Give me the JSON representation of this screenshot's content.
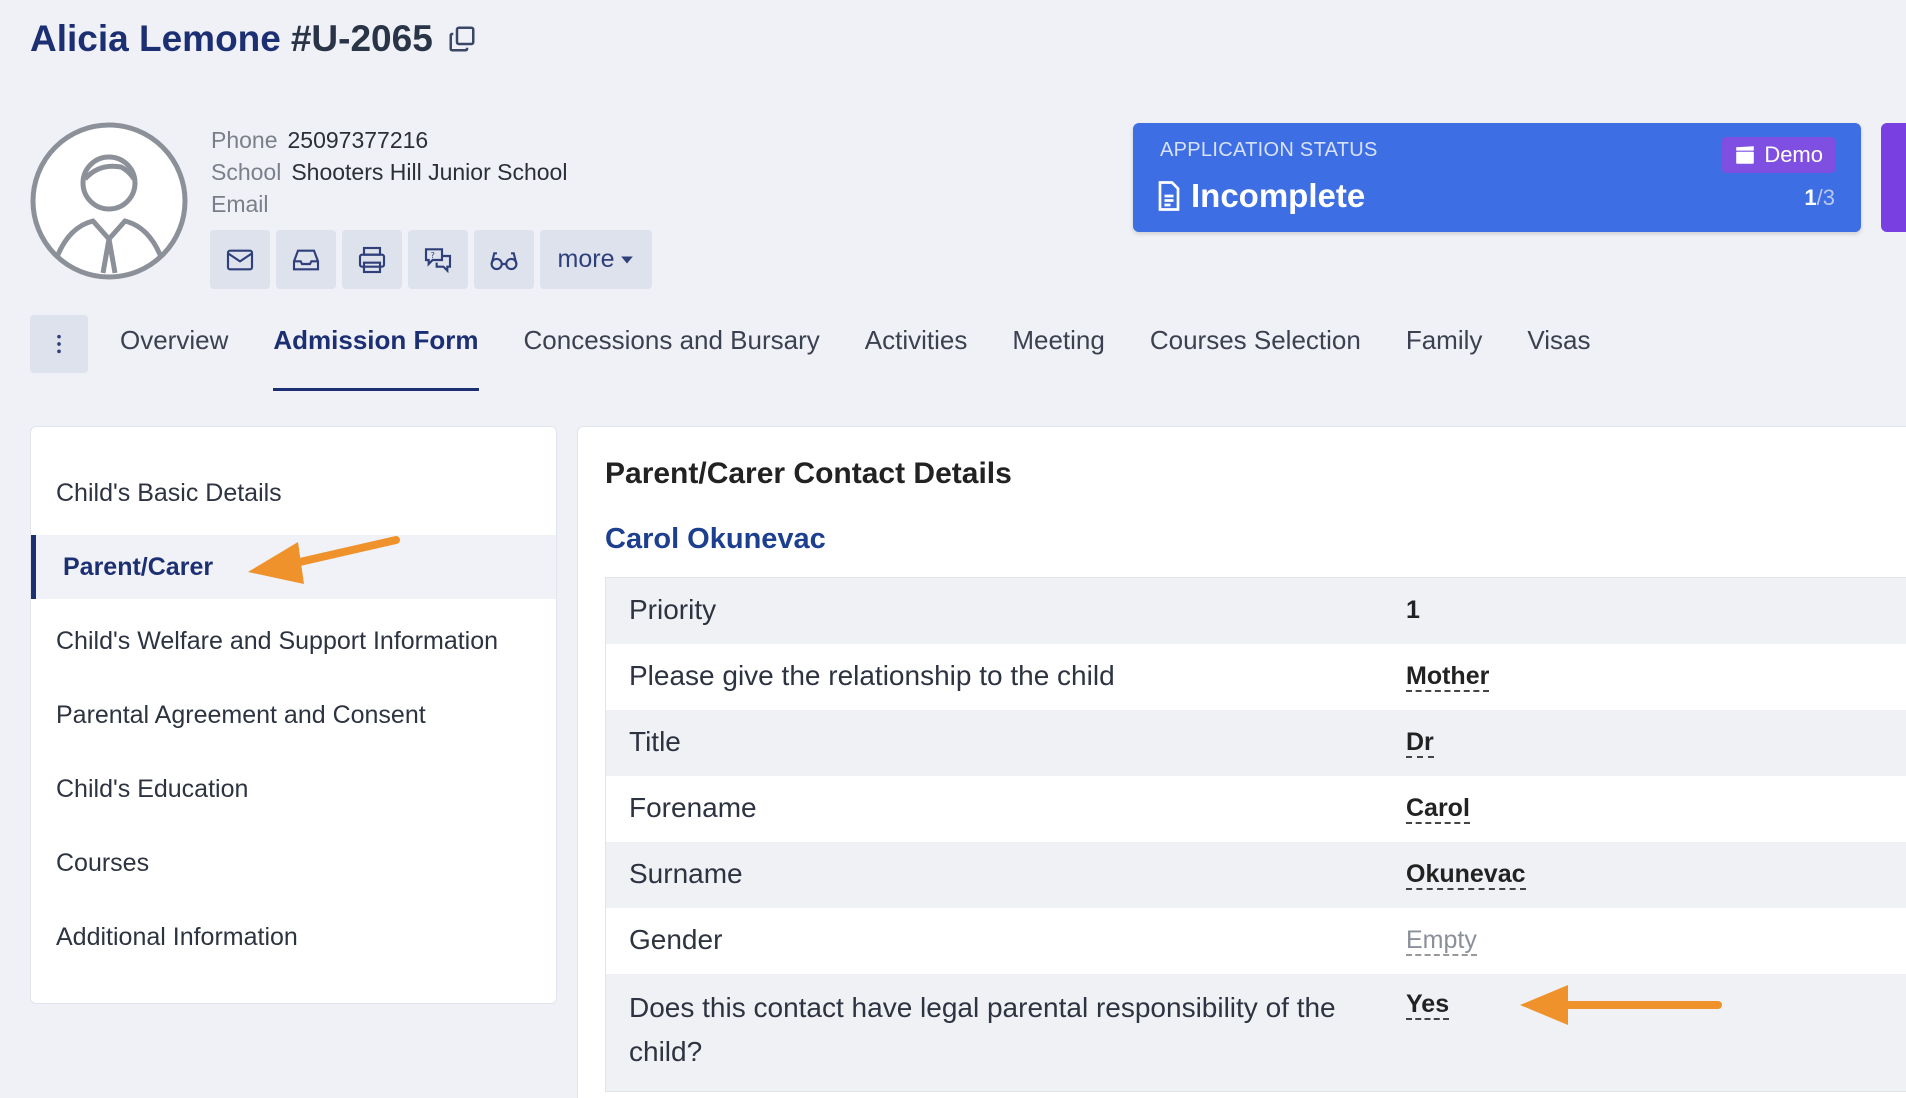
{
  "header": {
    "name": "Alicia Lemone",
    "uid": "#U-2065"
  },
  "profile": {
    "phone_label": "Phone",
    "phone_value": "25097377216",
    "school_label": "School",
    "school_value": "Shooters Hill Junior School",
    "email_label": "Email",
    "more_label": "more"
  },
  "status": {
    "caption": "APPLICATION STATUS",
    "value": "Incomplete",
    "badge": "Demo",
    "count_current": "1",
    "count_total": "/3"
  },
  "tabs": [
    {
      "label": "Overview"
    },
    {
      "label": "Admission Form"
    },
    {
      "label": "Concessions and Bursary"
    },
    {
      "label": "Activities"
    },
    {
      "label": "Meeting"
    },
    {
      "label": "Courses Selection"
    },
    {
      "label": "Family"
    },
    {
      "label": "Visas"
    }
  ],
  "sidenav": [
    {
      "label": "Child's Basic Details"
    },
    {
      "label": "Parent/Carer"
    },
    {
      "label": "Child's Welfare and Support Information"
    },
    {
      "label": "Parental Agreement and Consent"
    },
    {
      "label": "Child's Education"
    },
    {
      "label": "Courses"
    },
    {
      "label": "Additional Information"
    }
  ],
  "section": {
    "title": "Parent/Carer Contact Details",
    "contact_name": "Carol Okunevac",
    "rows": [
      {
        "q": "Priority",
        "a": "1"
      },
      {
        "q": "Please give the relationship to the child",
        "a": "Mother"
      },
      {
        "q": "Title",
        "a": "Dr"
      },
      {
        "q": "Forename",
        "a": "Carol"
      },
      {
        "q": "Surname",
        "a": "Okunevac"
      },
      {
        "q": "Gender",
        "a": "Empty"
      },
      {
        "q": "Does this contact have legal parental responsibility of the child?",
        "a": "Yes"
      }
    ]
  },
  "colors": {
    "brand_navy": "#1d2f73",
    "status_blue": "#3e6ee3",
    "demo_purple": "#7e4fe0",
    "annotation_arrow": "#f0922b"
  }
}
